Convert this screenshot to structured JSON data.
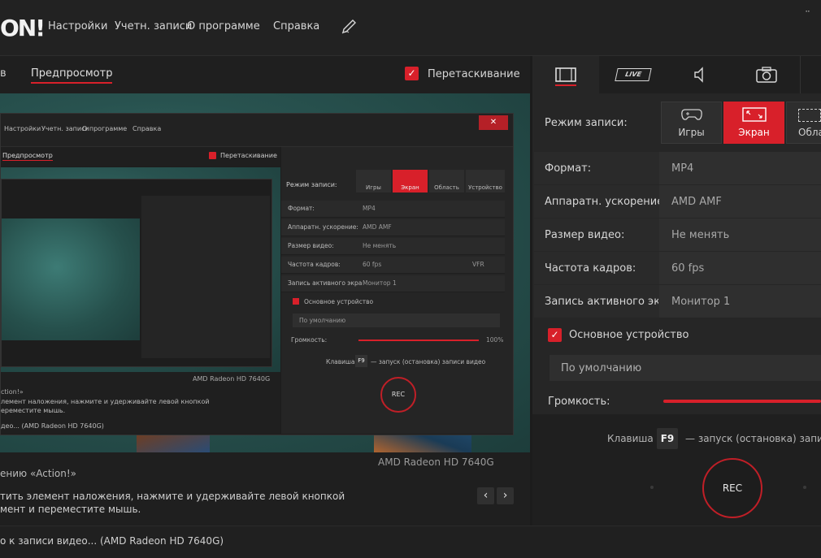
{
  "app": {
    "logo": "ON!",
    "close_glyph": "¨"
  },
  "menu": {
    "items": [
      "Настройки",
      "Учетн. записи",
      "О программе",
      "Справка"
    ]
  },
  "left_header": {
    "tab_partial": "в",
    "tab_preview": "Предпросмотр",
    "drag_label": "Перетаскивание"
  },
  "preview_footer": {
    "gpu": "AMD Radeon HD 7640G",
    "welcome": "ению «Action!»",
    "hint_line1": "тить элемент наложения, нажмите и удерживайте левой кнопкой",
    "hint_line2": "мент и переместите мышь.",
    "prev_glyph": "‹",
    "next_glyph": "›"
  },
  "status": {
    "text": "о к записи видео...  (AMD Radeon HD 7640G)"
  },
  "right_tabs": {
    "live_label": "LIVE"
  },
  "record_mode": {
    "label": "Режим записи:",
    "options": [
      {
        "label": "Игры",
        "icon": "gamepad-icon",
        "active": false
      },
      {
        "label": "Экран",
        "icon": "screen-icon",
        "active": true
      },
      {
        "label": "Обла",
        "icon": "region-icon",
        "active": false
      }
    ]
  },
  "settings": [
    {
      "label": "Формат:",
      "value": "MP4"
    },
    {
      "label": "Аппаратн. ускорение:",
      "value": "AMD AMF"
    },
    {
      "label": "Размер видео:",
      "value": "Не менять"
    },
    {
      "label": "Частота кадров:",
      "value": "60 fps"
    },
    {
      "label": "Запись активного экра",
      "value": "Монитор 1"
    }
  ],
  "audio": {
    "device_label": "Основное устройство",
    "device_value": "По умолчанию",
    "volume_label": "Громкость:",
    "volume_level": 1.0
  },
  "hotkey": {
    "prefix": "Клавиша",
    "key": "F9",
    "description": "— запуск (остановка) записи"
  },
  "rec_label": "REC",
  "nested": {
    "menu": [
      "Настройки",
      "Учетн. записи",
      "О программе",
      "Справка"
    ],
    "preview_tab": "Предпросмотр",
    "drag_label": "Перетаскивание",
    "mode_label": "Режим записи:",
    "modes": [
      "Игры",
      "Экран",
      "Область",
      "Устройство"
    ],
    "rows": [
      {
        "label": "Формат:",
        "value": "MP4"
      },
      {
        "label": "Аппаратн. ускорение:",
        "value": "AMD AMF"
      },
      {
        "label": "Размер видео:",
        "value": "Не менять"
      },
      {
        "label": "Частота кадров:",
        "value": "60 fps"
      },
      {
        "label": "Запись активного экра",
        "value": "Монитор 1"
      }
    ],
    "vfr": "VFR",
    "device": "Основное устройство",
    "device_value": "По умолчанию",
    "volume": "Громкость:",
    "volume_pct": "100%",
    "hotkey_prefix": "Клавиша",
    "hotkey_key": "F9",
    "hotkey_desc": "— запуск (остановка) записи видео",
    "rec": "REC",
    "gpu": "AMD Radeon HD 7640G",
    "welcome": "ction!»",
    "hint1": "лемент наложения, нажмите и удерживайте левой кнопкой",
    "hint2": "ереместите мышь.",
    "status": "део...  (AMD Radeon HD 7640G)"
  }
}
